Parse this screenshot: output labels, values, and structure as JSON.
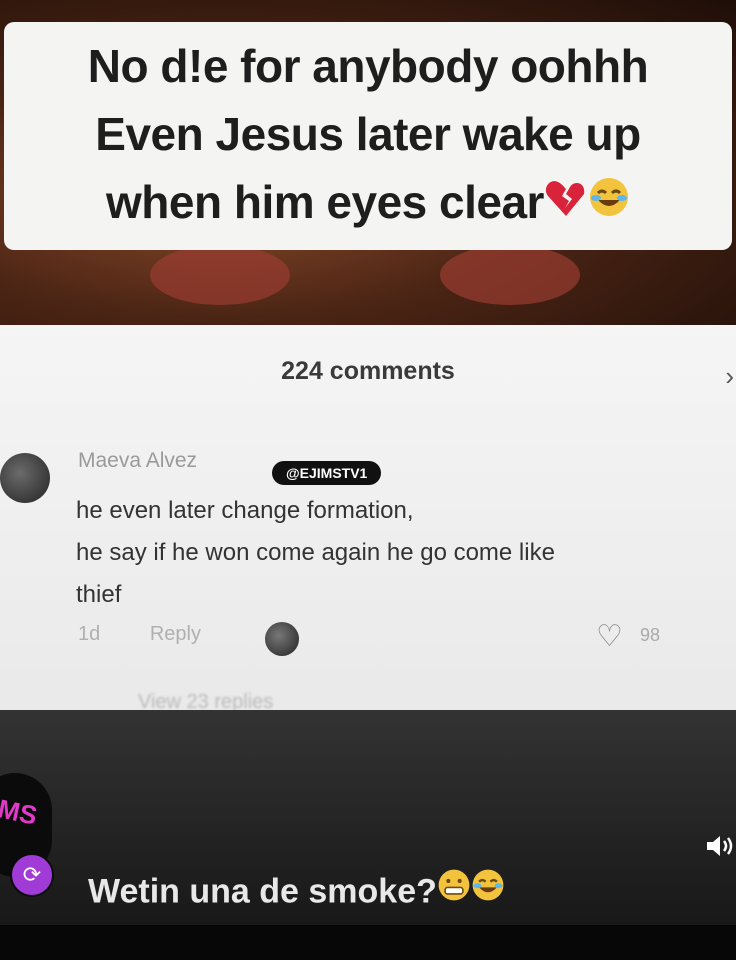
{
  "caption": {
    "line1": "No d!e for anybody oohhh",
    "line2": "Even Jesus later wake up",
    "line3": "when him eyes clear"
  },
  "comments_header": {
    "count_label": "224 comments"
  },
  "comment": {
    "author": "Maeva Alvez",
    "watermark": "@EJIMSTV1",
    "text_line1": "he even later change formation,",
    "text_line2": "he say if he won come again he go come like",
    "text_line3": "thief",
    "time": "1d",
    "reply_label": "Reply",
    "like_count": "98",
    "view_replies": "View 23 replies"
  },
  "post": {
    "caption": "Wetin una de smoke?"
  },
  "channel": {
    "logo_text": "MS"
  },
  "icons": {
    "heart": "heart-icon",
    "chevron": "chevron-right-icon",
    "volume": "volume-icon",
    "repost": "repost-icon"
  },
  "colors": {
    "caption_bg": "#f4f4f2",
    "caption_text": "#1e1e1e",
    "logo_accent": "#e23ac8",
    "repost_badge": "#a03bd8"
  }
}
